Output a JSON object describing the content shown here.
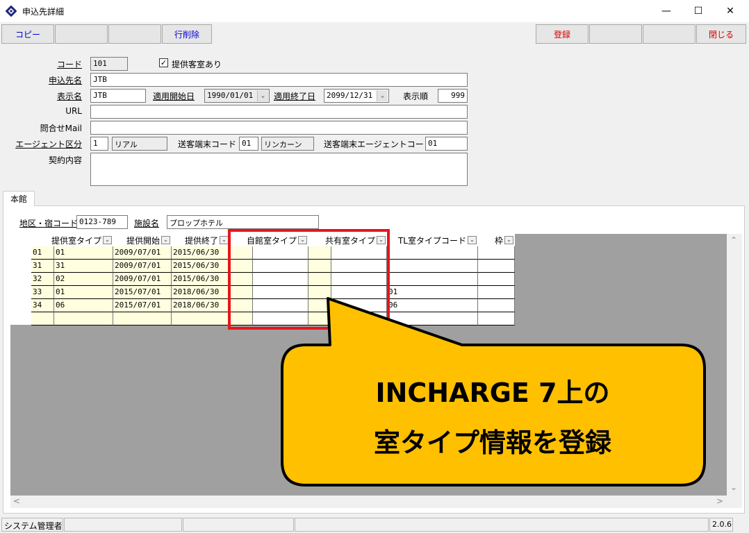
{
  "window": {
    "title": "申込先詳細",
    "minimize": "—",
    "maximize": "☐",
    "close": "✕"
  },
  "toolbar": {
    "copy": "コピー",
    "delete_row": "行削除",
    "register": "登録",
    "close_label": "閉じる"
  },
  "form": {
    "code_label": "コード",
    "code_value": "101",
    "provided_checkbox_label": "提供客室あり",
    "provided_checked": true,
    "applicant_label": "申込先名",
    "applicant_value": "JTB",
    "display_label": "表示名",
    "display_value": "JTB",
    "start_label": "適用開始日",
    "start_value": "1990/01/01",
    "end_label": "適用終了日",
    "end_value": "2099/12/31",
    "order_label": "表示順",
    "order_value": "999",
    "url_label": "URL",
    "url_value": "",
    "mail_label": "問合せMail",
    "mail_value": "",
    "agent_label": "エージェント区分",
    "agent_code": "1",
    "agent_name": "リアル",
    "terminal_label": "送客端末コード",
    "terminal_code": "01",
    "terminal_name": "リンカーン",
    "terminal_agent_label": "送客端末エージェントコード",
    "terminal_agent_code": "01",
    "contract_label": "契約内容",
    "contract_value": ""
  },
  "tab": {
    "label": "本館"
  },
  "facility": {
    "area_label": "地区・宿コード",
    "area_value": "0123-789",
    "name_label": "施設名",
    "name_value": "プロップホテル"
  },
  "grid": {
    "headers": [
      "提供室タイプ",
      "提供開始",
      "提供終了",
      "自館室タイプ",
      "共有室タイプ",
      "TL室タイプコード",
      "枠"
    ],
    "rows": [
      [
        "01",
        "01",
        "2009/07/01",
        "2015/06/30",
        "",
        "",
        "",
        ""
      ],
      [
        "31",
        "31",
        "2009/07/01",
        "2015/06/30",
        "",
        "",
        "",
        ""
      ],
      [
        "32",
        "02",
        "2009/07/01",
        "2015/06/30",
        "",
        "",
        "",
        ""
      ],
      [
        "33",
        "01",
        "2015/07/01",
        "2018/06/30",
        "",
        "",
        "01",
        ""
      ],
      [
        "34",
        "06",
        "2015/07/01",
        "2018/06/30",
        "",
        "",
        "06",
        ""
      ],
      [
        "",
        "",
        "",
        "",
        "",
        "",
        "",
        ""
      ]
    ]
  },
  "scroll": {
    "up": "⌃",
    "down": "⌄",
    "left": "<",
    "right": ">"
  },
  "status": {
    "user": "システム管理者",
    "version": "2.0.6"
  },
  "callout": {
    "line1": "INCHARGE 7上の",
    "line2": "室タイプ情報を登録"
  },
  "colors": {
    "callout_fill": "#ffc000",
    "highlight": "#e8141c",
    "blue_text": "#0000d0",
    "red_text": "#d00000"
  }
}
